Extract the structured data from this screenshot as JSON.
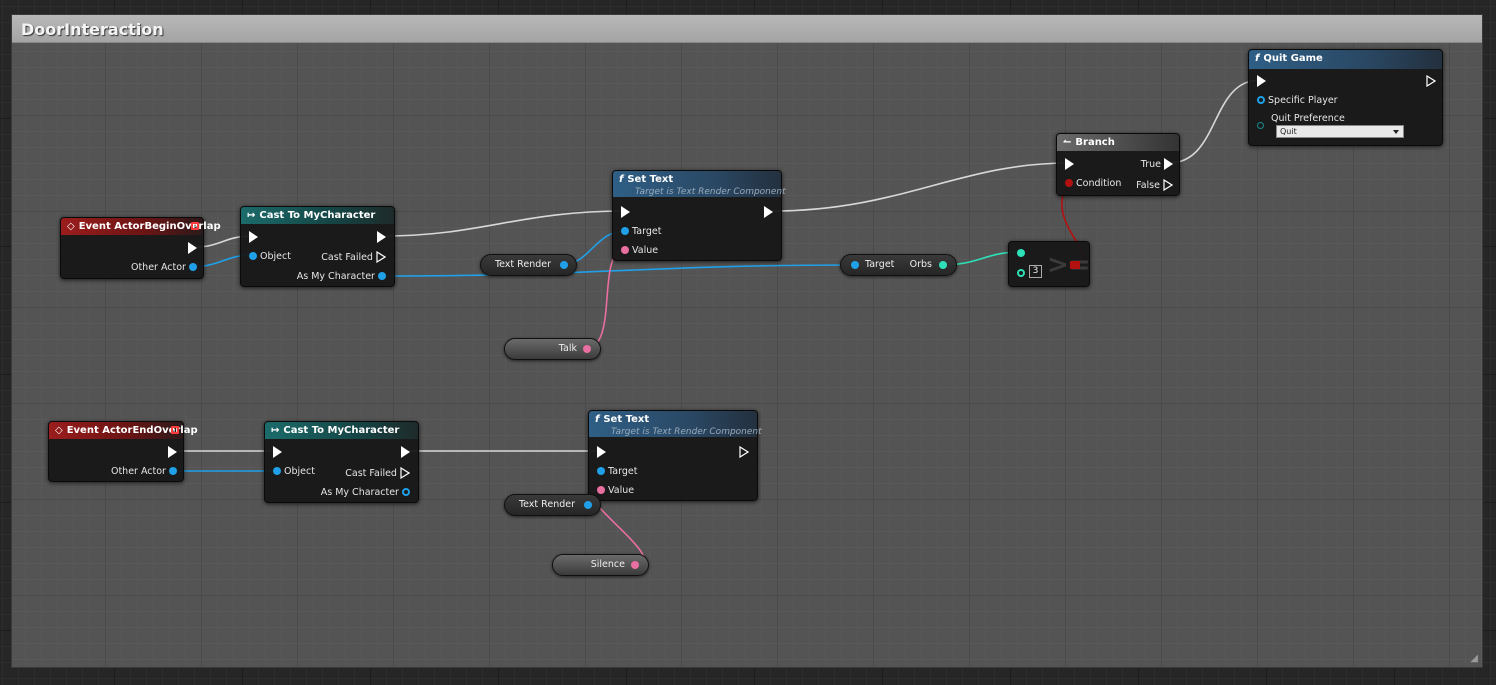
{
  "graph": {
    "comment_title": "DoorInteraction"
  },
  "nodes": {
    "begin_overlap": {
      "title": "Event ActorBeginOverlap",
      "other_actor": "Other Actor"
    },
    "end_overlap": {
      "title": "Event ActorEndOverlap",
      "other_actor": "Other Actor"
    },
    "cast1": {
      "title": "Cast To MyCharacter",
      "object": "Object",
      "cast_failed": "Cast Failed",
      "as": "As My Character"
    },
    "cast2": {
      "title": "Cast To MyCharacter",
      "object": "Object",
      "cast_failed": "Cast Failed",
      "as": "As My Character"
    },
    "settext1": {
      "title": "Set Text",
      "subtitle": "Target is Text Render Component",
      "target": "Target",
      "value": "Value"
    },
    "settext2": {
      "title": "Set Text",
      "subtitle": "Target is Text Render Component",
      "target": "Target",
      "value": "Value"
    },
    "branch": {
      "title": "Branch",
      "true_label": "True",
      "false_label": "False",
      "condition": "Condition"
    },
    "quit": {
      "title": "Quit Game",
      "specific_player": "Specific Player",
      "quit_pref": "Quit Preference",
      "quit_value": "Quit"
    },
    "compare": {
      "value": "3"
    },
    "orbs_get": {
      "target": "Target",
      "orbs": "Orbs"
    }
  },
  "variables": {
    "text_render_1": "Text Render",
    "text_render_2": "Text Render",
    "talk": "Talk",
    "silence": "Silence"
  },
  "colors": {
    "exec": "#ffffff",
    "object": "#1fa0e8",
    "text": "#e86fa0",
    "integer": "#2ee0b8",
    "boolean": "#b31010"
  }
}
